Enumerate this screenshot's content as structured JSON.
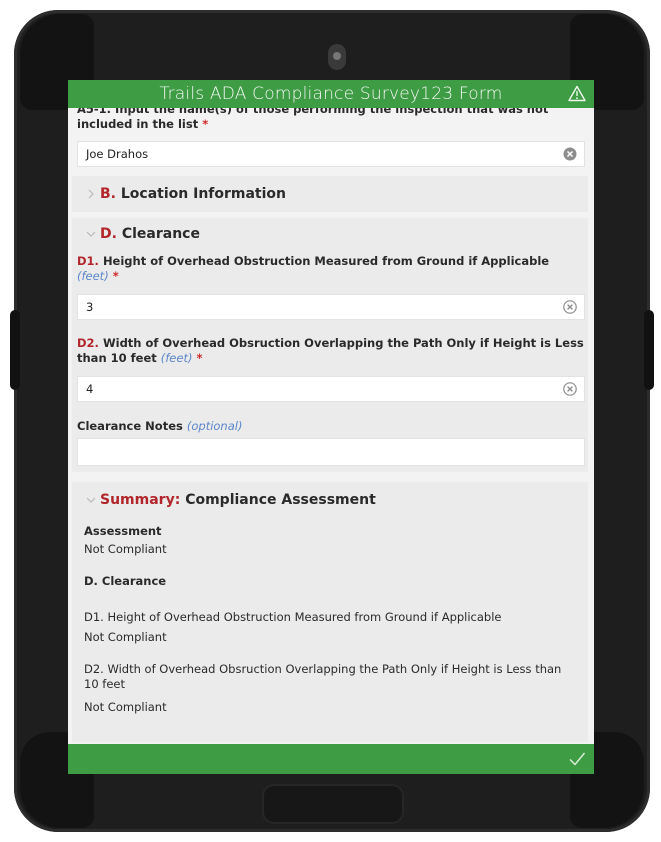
{
  "header": {
    "title": "Trails ADA Compliance Survey123 Form"
  },
  "a5": {
    "label": "A5-1. Input the name(s) of those performing the inspection that was not included in the list",
    "required_mark": "*",
    "value": "Joe Drahos"
  },
  "section_b": {
    "code": "B.",
    "title": "Location Information",
    "state": "collapsed"
  },
  "section_d": {
    "code": "D.",
    "title": "Clearance",
    "state": "expanded",
    "d1": {
      "code": "D1.",
      "label": "Height of Overhead Obstruction Measured from Ground if Applicable",
      "hint": "(feet)",
      "required_mark": "*",
      "value": "3"
    },
    "d2": {
      "code": "D2.",
      "label": "Width of Overhead Obsruction Overlapping the Path Only if Height is Less than 10 feet",
      "hint": "(feet)",
      "required_mark": "*",
      "value": "4"
    },
    "notes": {
      "label": "Clearance Notes",
      "hint": "(optional)",
      "value": ""
    }
  },
  "summary": {
    "code": "Summary:",
    "title": "Compliance Assessment",
    "state": "expanded",
    "assessment_label": "Assessment",
    "assessment_value": "Not Compliant",
    "section_title": "D. Clearance",
    "items": [
      {
        "label": "D1. Height of Overhead Obstruction Measured from Ground if Applicable",
        "value": "Not Compliant"
      },
      {
        "label": "D2. Width of Overhead Obsruction Overlapping the Path Only if Height is Less than 10 feet",
        "value": "Not Compliant"
      }
    ]
  },
  "icons": {
    "warning": "warning-icon",
    "submit": "checkmark-icon",
    "clear": "clear-icon",
    "collapsed": "chevron-right-icon",
    "expanded": "chevron-down-icon"
  },
  "colors": {
    "bar": "#3e9c45",
    "required": "#d02a2a",
    "hint": "#5b86c9"
  }
}
